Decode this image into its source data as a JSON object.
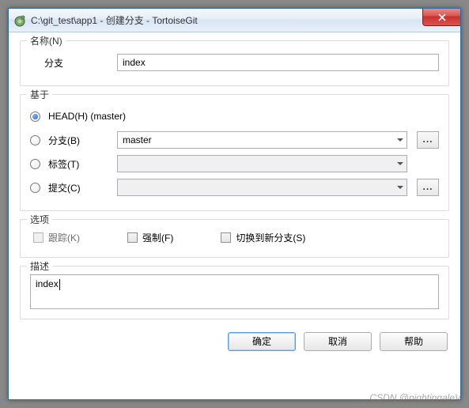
{
  "window": {
    "title": "C:\\git_test\\app1 - 创建分支 - TortoiseGit"
  },
  "groups": {
    "name": {
      "legend": "名称(N)",
      "branch_label": "分支",
      "branch_value": "index"
    },
    "based_on": {
      "legend": "基于",
      "head": {
        "label": "HEAD(H) (master)"
      },
      "branch": {
        "label": "分支(B)",
        "value": "master"
      },
      "tag": {
        "label": "标签(T)",
        "value": ""
      },
      "commit": {
        "label": "提交(C)",
        "value": ""
      },
      "browse": "..."
    },
    "options": {
      "legend": "选项",
      "track": "跟踪(K)",
      "force": "强制(F)",
      "switch": "切换到新分支(S)"
    },
    "desc": {
      "legend": "描述",
      "value": "index"
    }
  },
  "buttons": {
    "ok": "确定",
    "cancel": "取消",
    "help": "帮助"
  },
  "watermark": "CSDN @nightingaleV"
}
